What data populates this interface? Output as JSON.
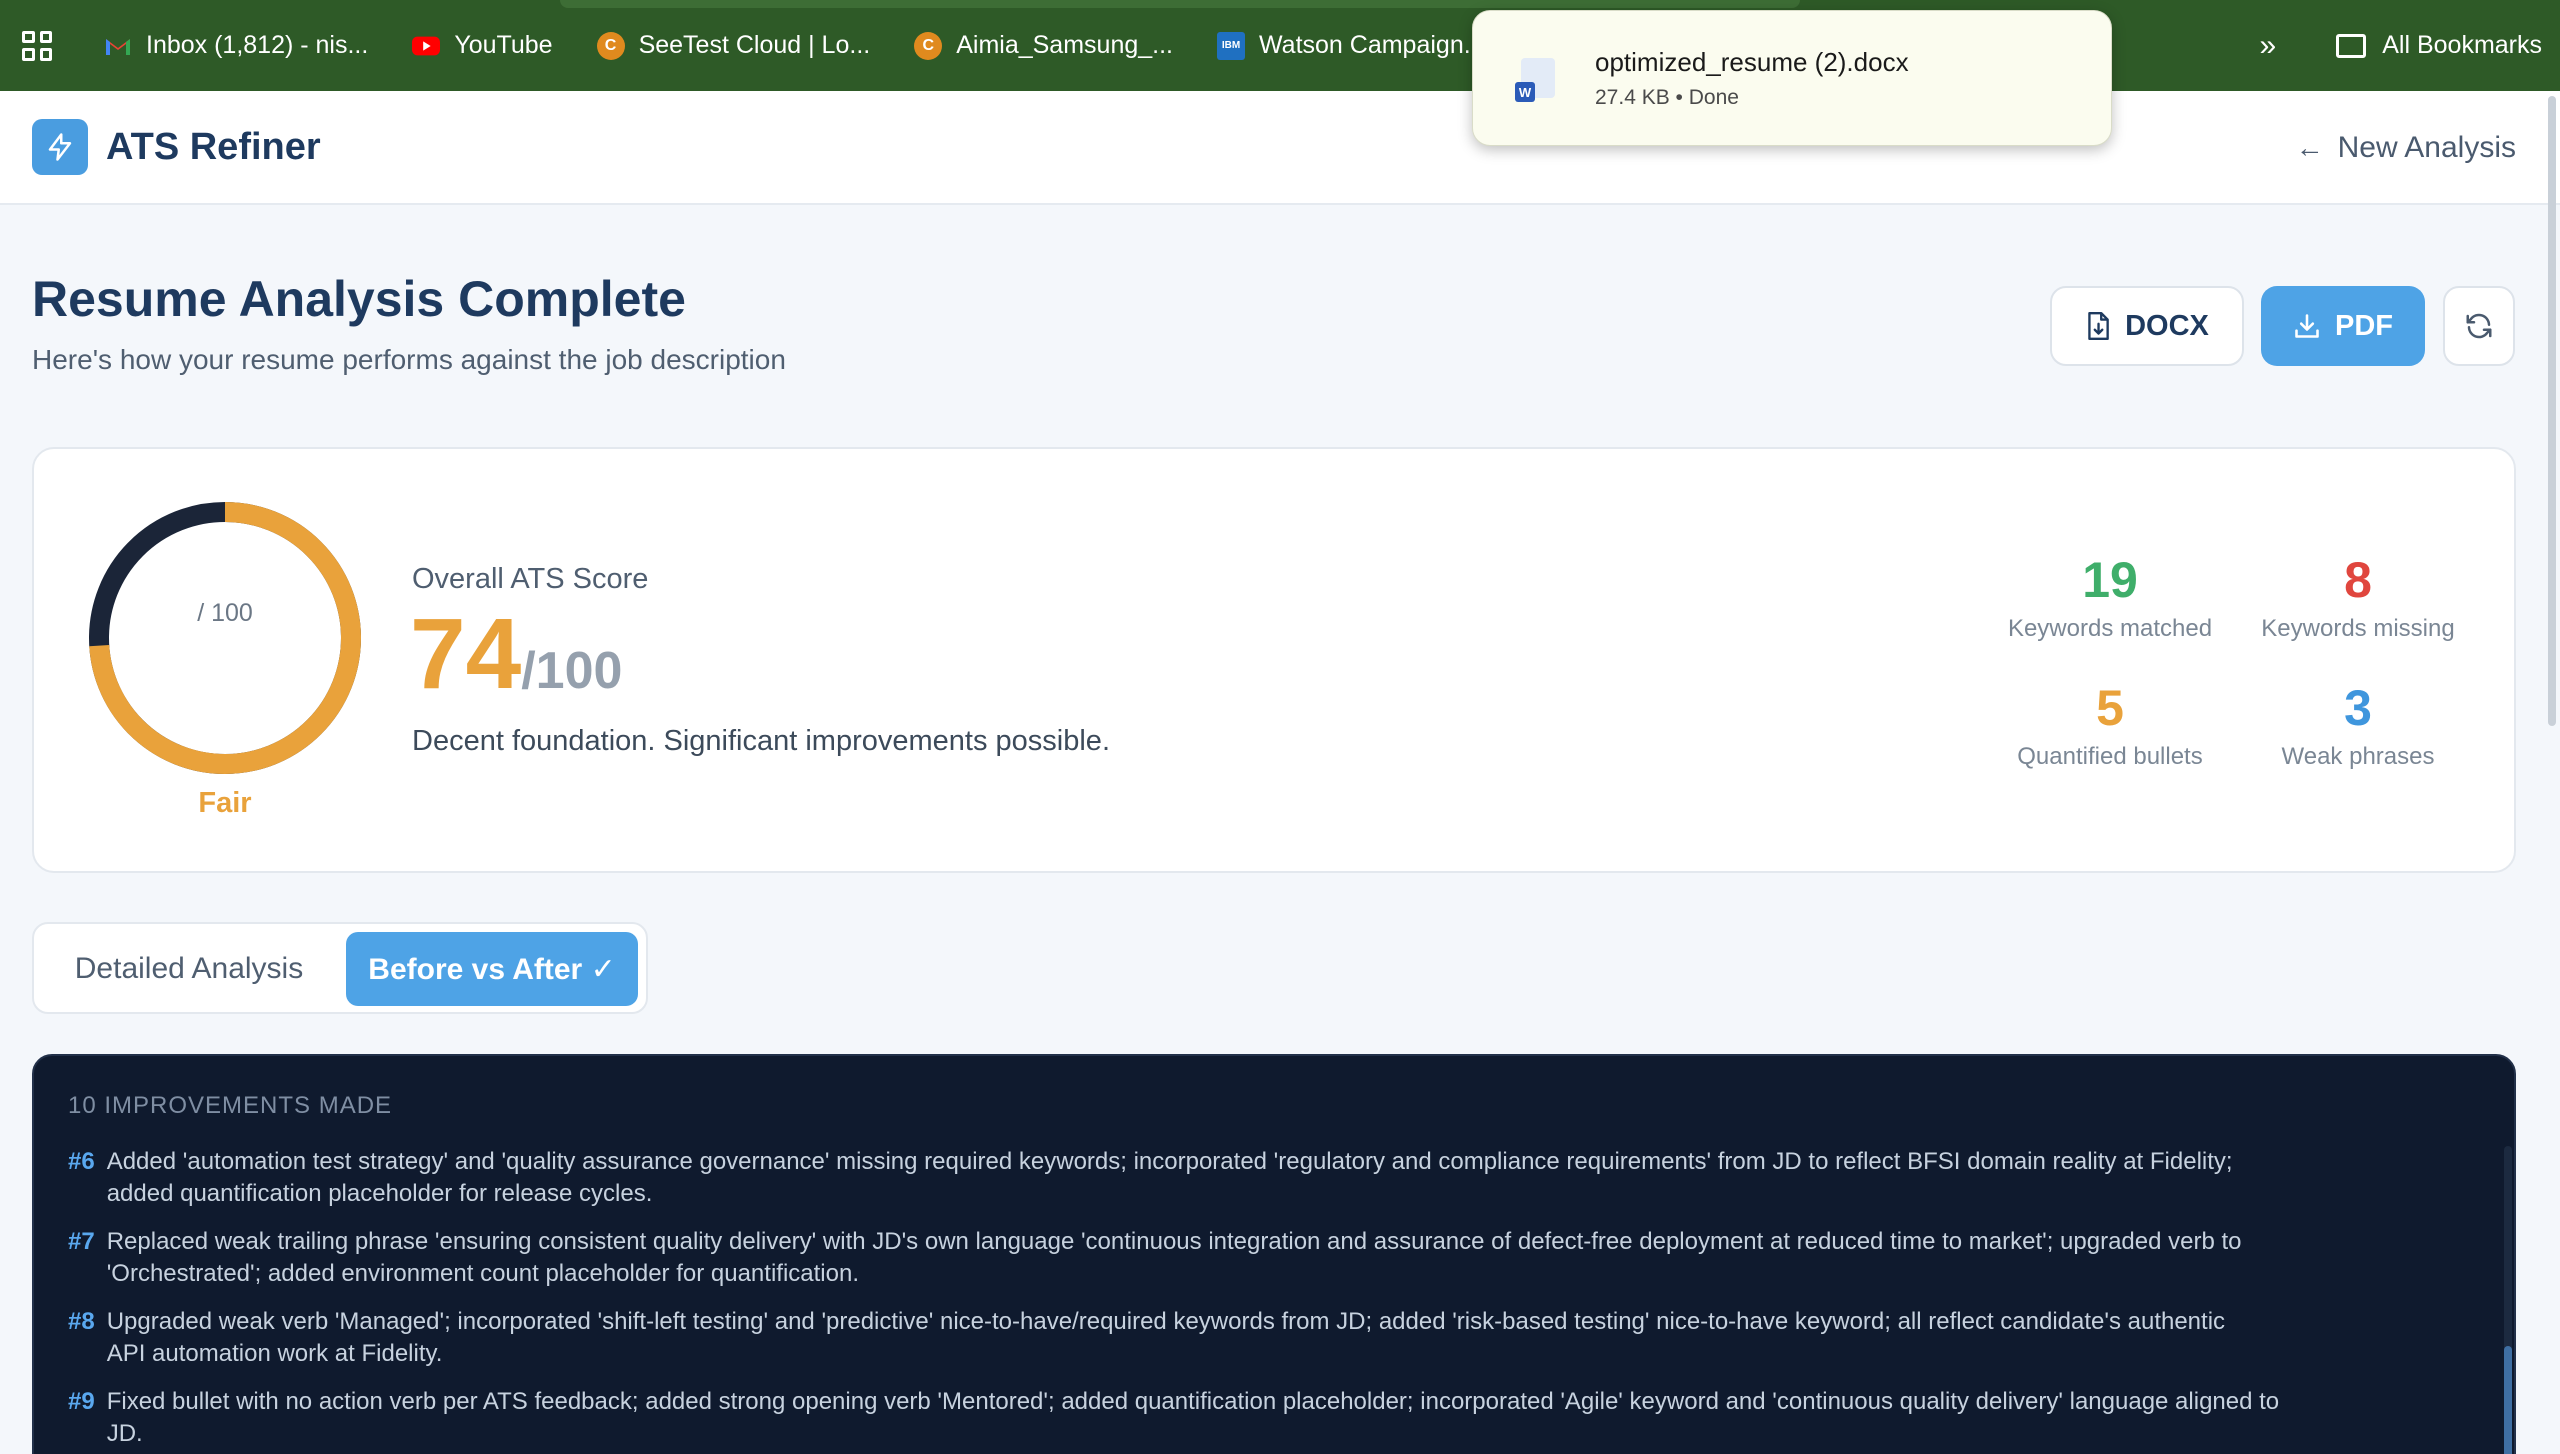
{
  "bookmarks": {
    "items": [
      {
        "label": "Inbox (1,812) - nis...",
        "icon": "gmail-icon",
        "color": "#d93025"
      },
      {
        "label": "YouTube",
        "icon": "youtube-icon",
        "color": "#ff0000"
      },
      {
        "label": "SeeTest Cloud | Lo...",
        "icon": "seetest-icon",
        "color": "#e08a1e"
      },
      {
        "label": "Aimia_Samsung_...",
        "icon": "aimia-icon",
        "color": "#e08a1e"
      },
      {
        "label": "Watson Campaign...",
        "icon": "ibm-icon",
        "color": "#1f70c1"
      }
    ],
    "all_bookmarks": "All Bookmarks"
  },
  "download": {
    "filename": "optimized_resume (2).docx",
    "meta": "27.4 KB • Done"
  },
  "header": {
    "brand": "ATS Refiner",
    "new_analysis": "New Analysis"
  },
  "page": {
    "title": "Resume Analysis Complete",
    "subtitle": "Here's how your resume performs against the job description"
  },
  "actions": {
    "docx": "DOCX",
    "pdf": "PDF"
  },
  "score": {
    "ring_label": "/ 100",
    "rating": "Fair",
    "overall_label": "Overall ATS Score",
    "value": "74",
    "max": "/100",
    "fraction": 0.74,
    "description": "Decent foundation. Significant improvements possible.",
    "colors": {
      "accent": "#e9a23b",
      "track": "#1b2538"
    }
  },
  "stats": [
    {
      "num": "19",
      "label": "Keywords matched",
      "color": "#3fae6a"
    },
    {
      "num": "8",
      "label": "Keywords missing",
      "color": "#e0463e"
    },
    {
      "num": "5",
      "label": "Quantified bullets",
      "color": "#e9a23b"
    },
    {
      "num": "3",
      "label": "Weak phrases",
      "color": "#3f96dd"
    }
  ],
  "tabs": {
    "detailed": "Detailed Analysis",
    "before_after": "Before vs After ✓"
  },
  "improvements": {
    "title": "10 IMPROVEMENTS MADE",
    "items": [
      {
        "num": "#6",
        "line1": "Added 'automation test strategy' and 'quality assurance governance' missing required keywords; incorporated 'regulatory and compliance requirements' from JD to reflect BFSI domain reality at Fidelity;",
        "line2": "added quantification placeholder for release cycles."
      },
      {
        "num": "#7",
        "line1": "Replaced weak trailing phrase 'ensuring consistent quality delivery' with JD's own language 'continuous integration and assurance of defect-free deployment at reduced time to market'; upgraded verb to",
        "line2": "'Orchestrated'; added environment count placeholder for quantification."
      },
      {
        "num": "#8",
        "line1": "Upgraded weak verb 'Managed'; incorporated 'shift-left testing' and 'predictive' nice-to-have/required keywords from JD; added 'risk-based testing' nice-to-have keyword; all reflect candidate's authentic",
        "line2": "API automation work at Fidelity."
      },
      {
        "num": "#9",
        "line1": "Fixed bullet with no action verb per ATS feedback; added strong opening verb 'Mentored'; added quantification placeholder; incorporated 'Agile' keyword and 'continuous quality delivery' language aligned to",
        "line2": "JD."
      }
    ]
  }
}
